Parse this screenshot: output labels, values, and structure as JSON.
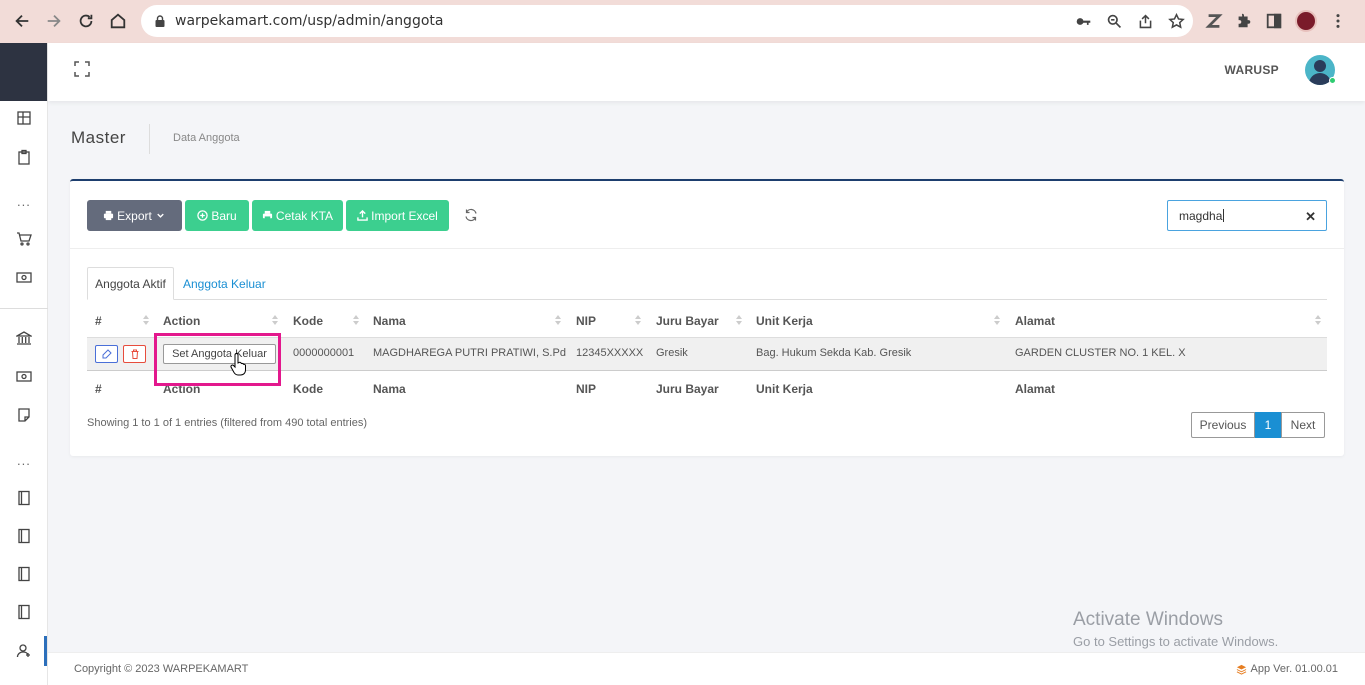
{
  "browser": {
    "url": "warpekamart.com/usp/admin/anggota"
  },
  "topbar": {
    "user_name": "WARUSP"
  },
  "page": {
    "title": "Master",
    "breadcrumb": "Data Anggota"
  },
  "toolbar": {
    "export_label": "Export",
    "new_label": "Baru",
    "print_label": "Cetak KTA",
    "import_label": "Import Excel"
  },
  "search": {
    "value": "magdha"
  },
  "tabs": {
    "active": "Anggota Aktif",
    "other": "Anggota Keluar"
  },
  "table": {
    "columns": [
      "#",
      "Action",
      "Kode",
      "Nama",
      "NIP",
      "Juru Bayar",
      "Unit Kerja",
      "Alamat"
    ],
    "rows": [
      {
        "set_button": "Set Anggota Keluar",
        "kode": "0000000001",
        "nama": "MAGDHAREGA PUTRI PRATIWI, S.Pd",
        "nip": "12345XXXXX",
        "juru_bayar": "Gresik",
        "unit_kerja": "Bag. Hukum Sekda Kab. Gresik",
        "alamat": "GARDEN CLUSTER NO. 1 KEL. X"
      }
    ]
  },
  "info": "Showing 1 to 1 of 1 entries (filtered from 490 total entries)",
  "pagination": {
    "previous": "Previous",
    "current": "1",
    "next": "Next"
  },
  "footer": {
    "copyright": "Copyright © 2023 WARPEKAMART",
    "version": "App Ver. 01.00.01"
  },
  "watermark": {
    "line1": "Activate Windows",
    "line2": "Go to Settings to activate Windows."
  },
  "colors": {
    "accent_green": "#3ccf8f",
    "export_gray": "#646b7c",
    "link_blue": "#1a8fd3",
    "highlight_pink": "#e3188d"
  }
}
